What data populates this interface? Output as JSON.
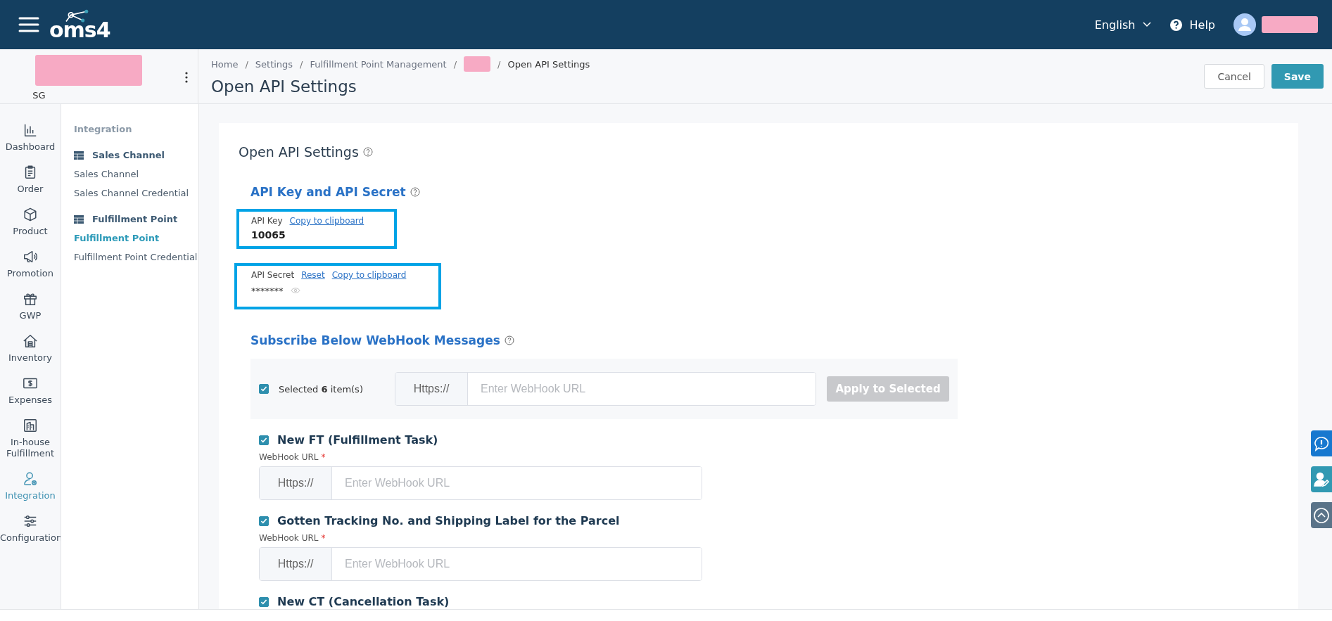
{
  "header": {
    "logo": "oms4",
    "language": "English",
    "help": "Help"
  },
  "account": {
    "region": "SG"
  },
  "breadcrumb": [
    {
      "kind": "link",
      "label": "Home"
    },
    {
      "kind": "link",
      "separator": "/",
      "label": "Settings"
    },
    {
      "kind": "link",
      "separator": "/",
      "label": "Fulfillment Point Management"
    },
    {
      "kind": "redacted",
      "separator": "/"
    },
    {
      "kind": "current",
      "separator": "/",
      "label": "Open API Settings"
    }
  ],
  "page_title": "Open API Settings",
  "actions": [
    {
      "kind": "secondary",
      "label": "Cancel"
    },
    {
      "kind": "primary",
      "label": "Save"
    }
  ],
  "nav": [
    {
      "label": "Dashboard",
      "selected": false
    },
    {
      "label": "Order",
      "selected": false
    },
    {
      "label": "Product",
      "selected": false
    },
    {
      "label": "Promotion",
      "selected": false
    },
    {
      "label": "GWP",
      "selected": false
    },
    {
      "label": "Inventory",
      "selected": false
    },
    {
      "label": "Expenses",
      "selected": false
    },
    {
      "label": "In-house Fulfillment",
      "selected": false
    },
    {
      "label": "Integration",
      "selected": true
    },
    {
      "label": "Configuration",
      "selected": false
    }
  ],
  "subnav": {
    "title": "Integration",
    "groups": [
      {
        "label": "Sales Channel",
        "items": [
          {
            "label": "Sales Channel",
            "selected": false
          },
          {
            "label": "Sales Channel Credential",
            "selected": false
          }
        ]
      },
      {
        "label": "Fulfillment Point",
        "items": [
          {
            "label": "Fulfillment Point",
            "selected": true
          },
          {
            "label": "Fulfillment Point Credential",
            "selected": false
          }
        ]
      }
    ]
  },
  "card": {
    "title": "Open API Settings",
    "credentials_heading": "API Key and API Secret",
    "api_key": {
      "label": "API Key",
      "links": [
        "Copy to clipboard"
      ],
      "value": "10065"
    },
    "api_secret": {
      "label": "API Secret",
      "links": [
        "Reset",
        "Copy to clipboard"
      ],
      "value": "*******"
    },
    "webhook_heading": "Subscribe Below WebHook Messages",
    "bulk": {
      "checked": true,
      "text": "Selected **6** item(s)",
      "prefix": "Https://",
      "placeholder": "Enter WebHook URL",
      "button": "Apply to Selected",
      "button_disabled": true
    },
    "messages": [
      {
        "title": "New FT (Fulfillment Task)",
        "checked": true,
        "field_label": "WebHook URL",
        "required_mark": "*",
        "prefix": "Https://",
        "placeholder": "Enter WebHook URL"
      },
      {
        "title": "Gotten Tracking No. and Shipping Label for the Parcel",
        "checked": true,
        "field_label": "WebHook URL",
        "required_mark": "*",
        "prefix": "Https://",
        "placeholder": "Enter WebHook URL"
      },
      {
        "title": "New CT (Cancellation Task)",
        "checked": true
      }
    ]
  }
}
